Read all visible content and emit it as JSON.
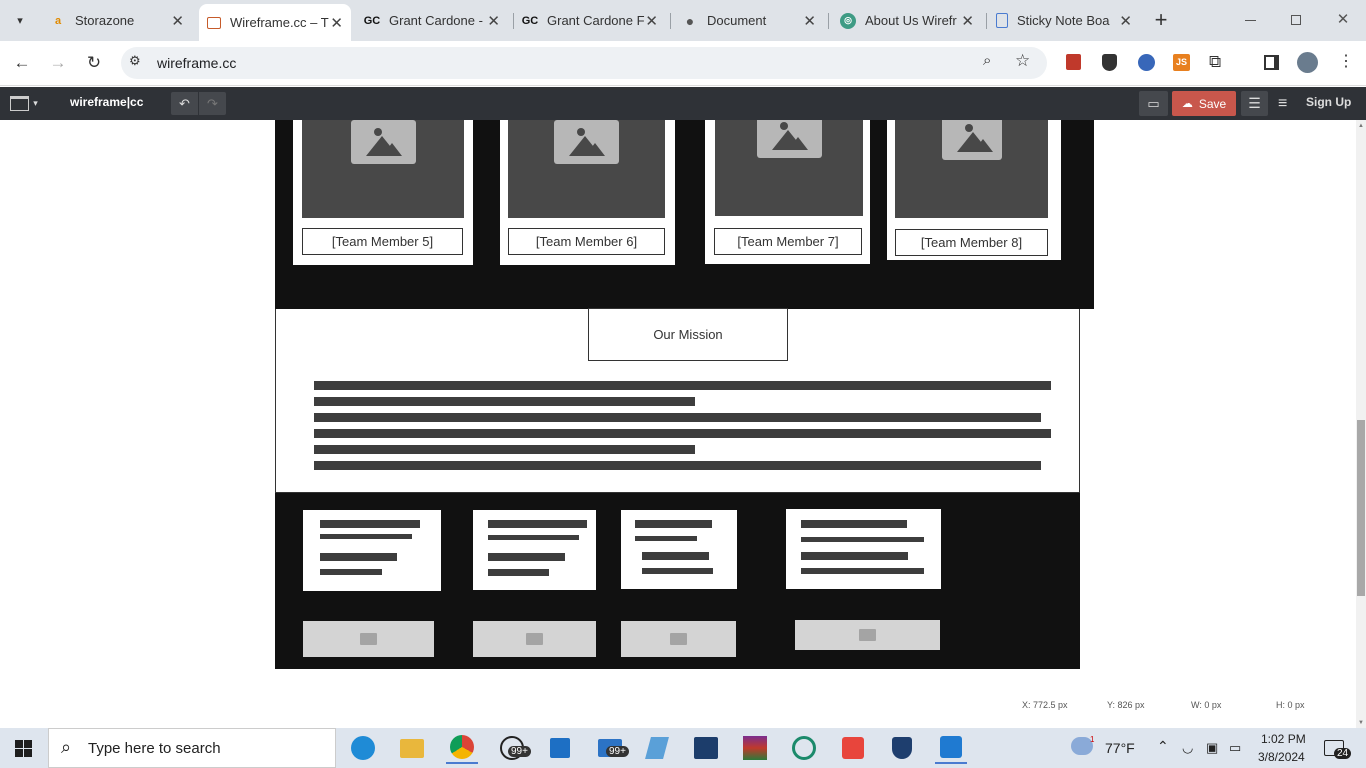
{
  "browser": {
    "tabs": [
      {
        "title": "Storazone",
        "icon": "amazon-icon"
      },
      {
        "title": "Wireframe.cc – T",
        "icon": "wireframe-icon",
        "active": true
      },
      {
        "title": "Grant Cardone -",
        "icon": "gc-icon"
      },
      {
        "title": "Grant Cardone F",
        "icon": "gc-icon"
      },
      {
        "title": "Document",
        "icon": "globe-icon"
      },
      {
        "title": "About Us Wirefr",
        "icon": "chatgpt-icon"
      },
      {
        "title": "Sticky Note Boa",
        "icon": "doc-icon"
      }
    ],
    "close_glyph": "✕",
    "new_tab_glyph": "+",
    "url": "wireframe.cc"
  },
  "app": {
    "logo": "wireframe|cc",
    "save_label": "Save",
    "signup_label": "Sign Up"
  },
  "wireframe": {
    "team_members": [
      "[Team Member 5]",
      "[Team Member 6]",
      "[Team Member 7]",
      "[Team Member 8]"
    ],
    "mission_title": "Our Mission"
  },
  "status": {
    "x": "X: 772.5 px",
    "y": "Y: 826 px",
    "w": "W: 0 px",
    "h": "H: 0 px"
  },
  "taskbar": {
    "search_placeholder": "Type here to search",
    "badge_whatsapp": "99+",
    "badge_mail": "99+",
    "weather": "77°F",
    "weather_alert": "1",
    "time": "1:02 PM",
    "date": "3/8/2024",
    "notifications": "24"
  },
  "colors": {
    "toolbar": "#2f3237",
    "save": "#c8574c",
    "section_dark": "#111111"
  }
}
